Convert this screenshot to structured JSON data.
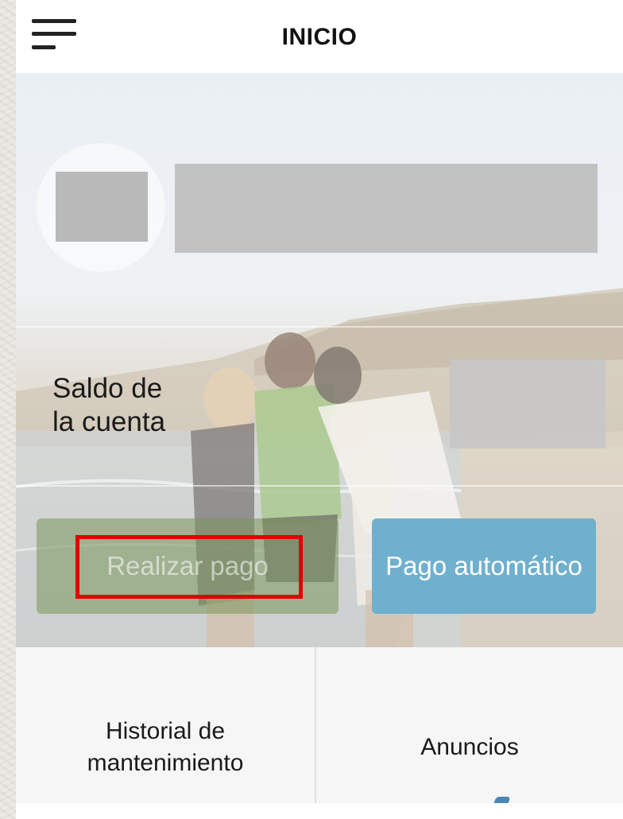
{
  "header": {
    "title": "INICIO",
    "menu_icon": "hamburger-menu-icon"
  },
  "profile": {
    "avatar": "profile-avatar",
    "name": ""
  },
  "account": {
    "balance_label": "Saldo de\nla cuenta",
    "balance_value": ""
  },
  "actions": {
    "pay_label": "Realizar pago",
    "autopay_label": "Pago automático",
    "autopay_color": "#6fb0ce",
    "highlight_color": "#e00000"
  },
  "tiles": [
    {
      "label": "Historial de\nmantenimiento"
    },
    {
      "label": "Anuncios"
    }
  ]
}
